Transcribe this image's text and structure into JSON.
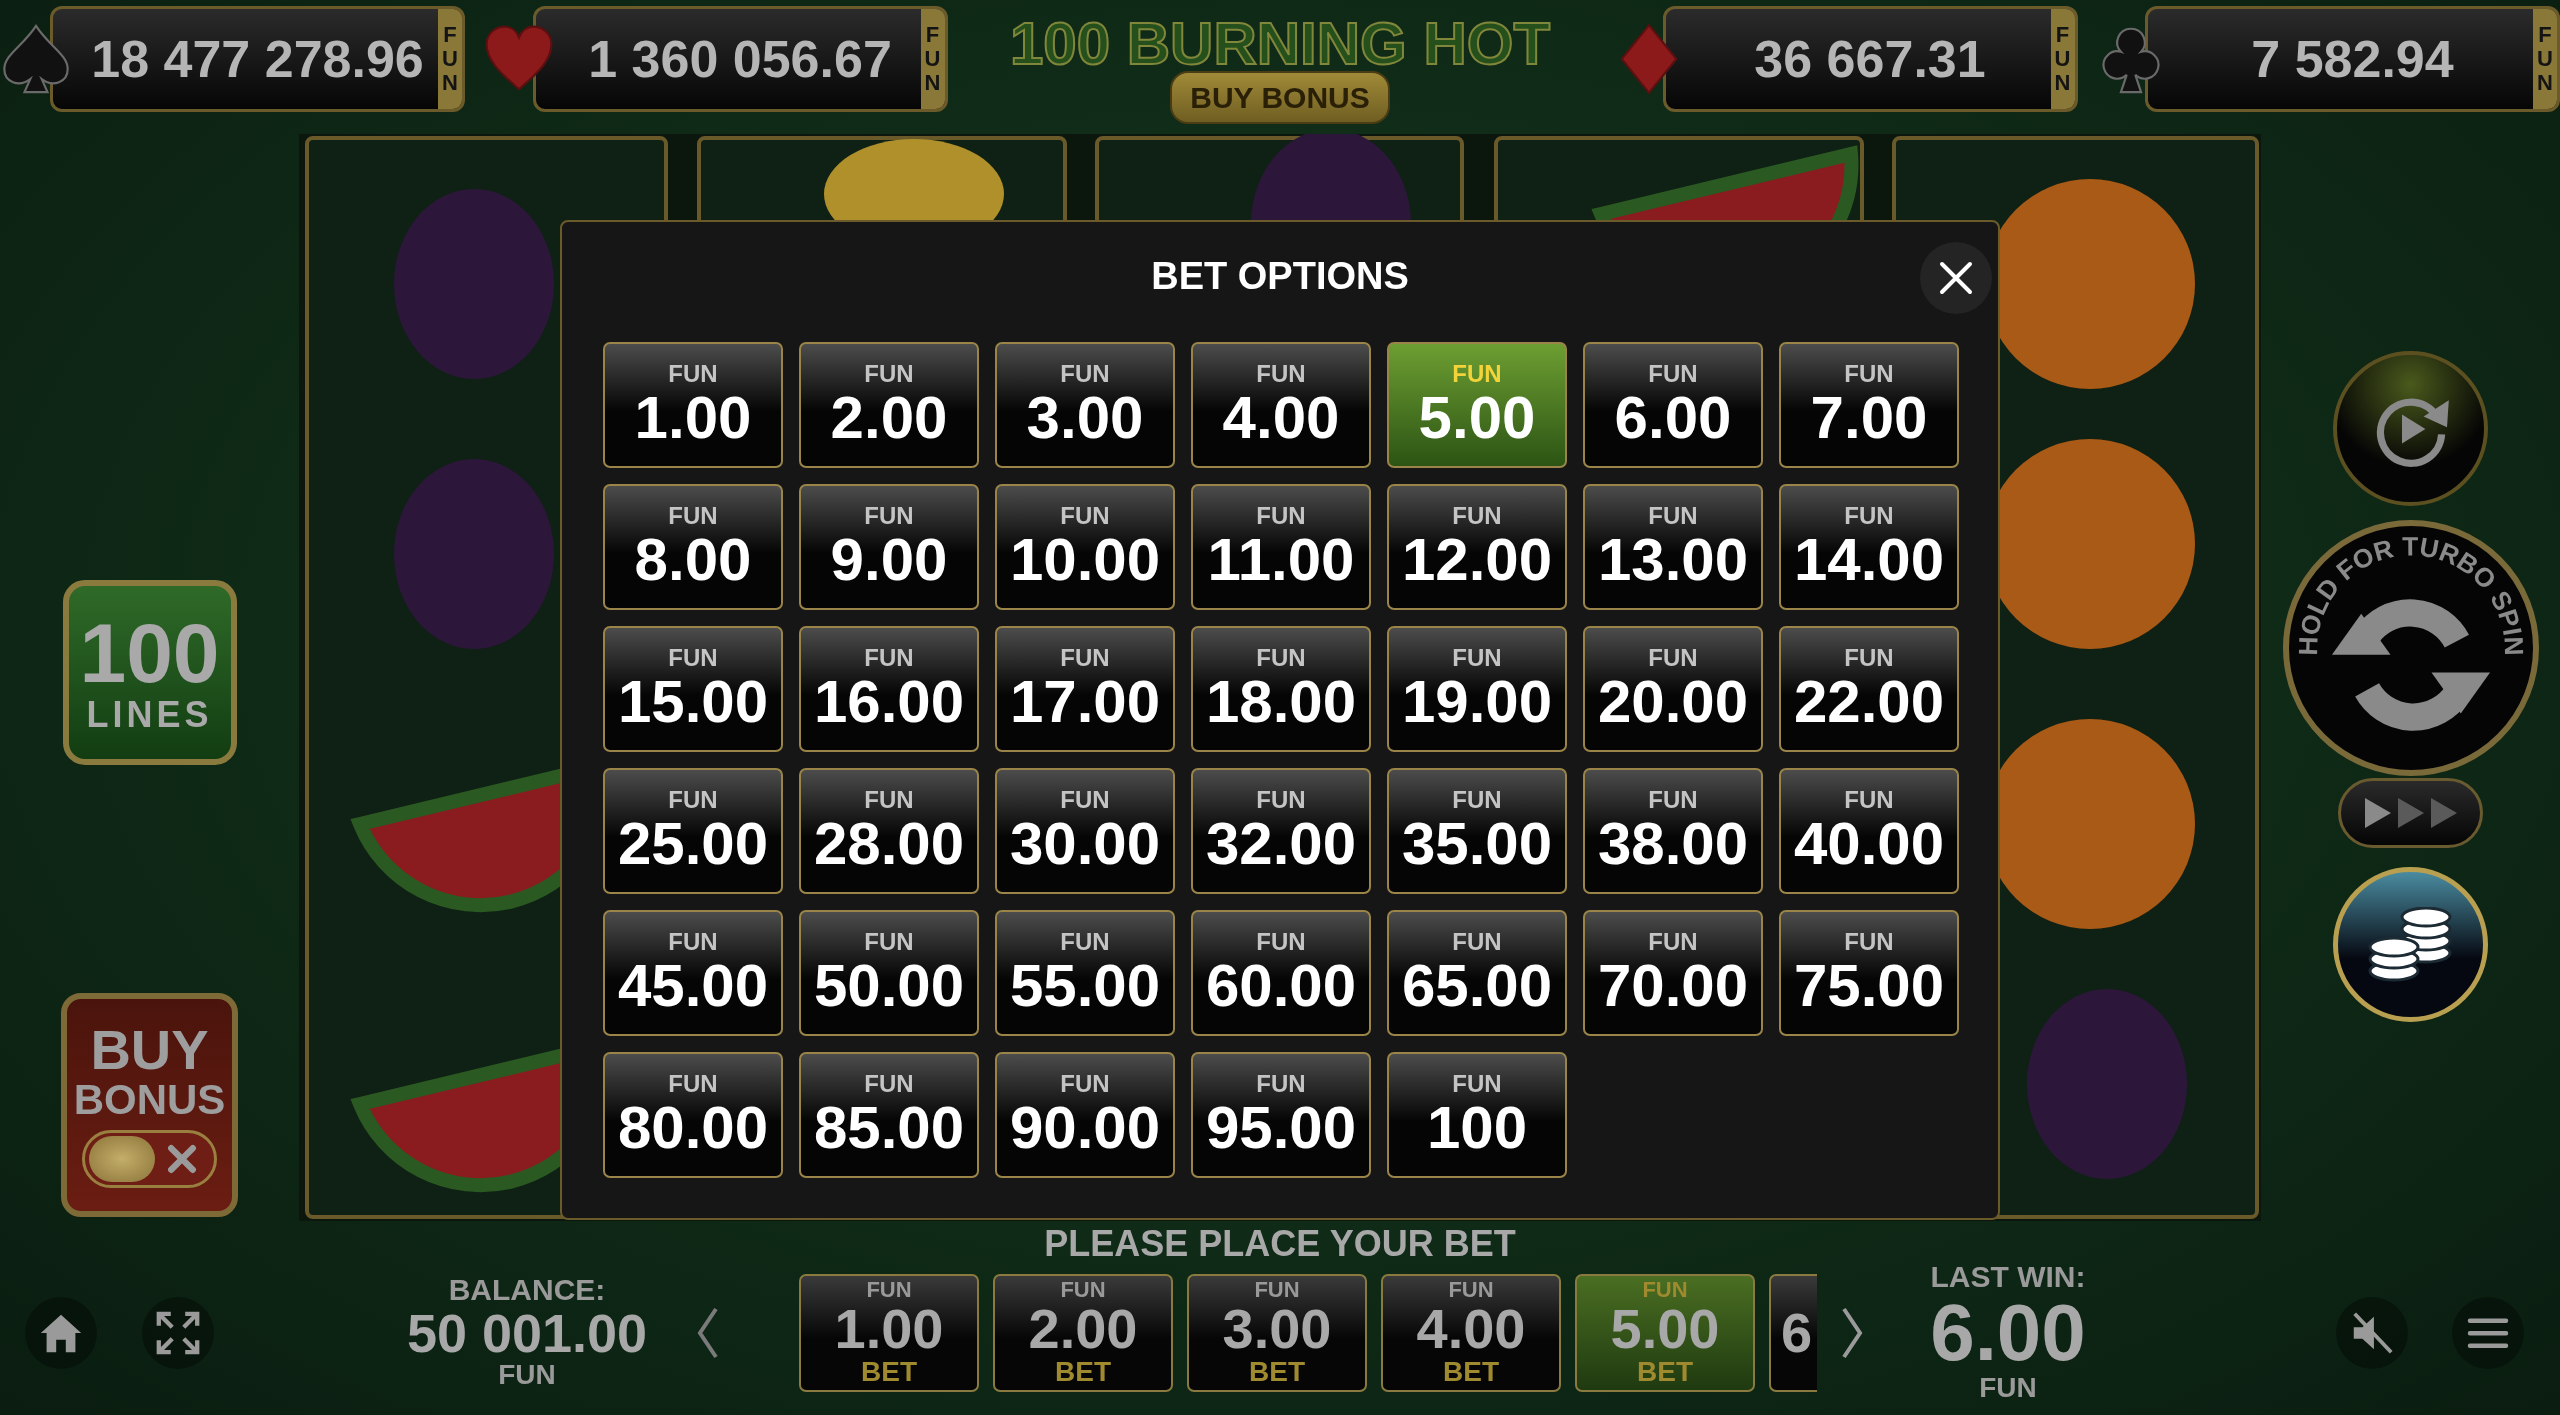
{
  "jackpots": [
    {
      "kind": "spade",
      "amount": "18 477 278.96",
      "currency": "FUN"
    },
    {
      "kind": "heart",
      "amount": "1 360 056.67",
      "currency": "FUN"
    },
    {
      "kind": "diamond",
      "amount": "36 667.31",
      "currency": "FUN"
    },
    {
      "kind": "club",
      "amount": "7 582.94",
      "currency": "FUN"
    }
  ],
  "game_title": "100 BURNING HOT",
  "title_badge": "BUY BONUS",
  "lines_badge": {
    "number": "100",
    "label": "LINES"
  },
  "buy_bonus_button": {
    "line1": "BUY",
    "line2": "BONUS",
    "on": false
  },
  "turbo_button": {
    "label": "HOLD FOR TURBO SPIN"
  },
  "dialog": {
    "title": "BET OPTIONS",
    "options": [
      {
        "currency": "FUN",
        "amount": "1.00",
        "selected": false
      },
      {
        "currency": "FUN",
        "amount": "2.00",
        "selected": false
      },
      {
        "currency": "FUN",
        "amount": "3.00",
        "selected": false
      },
      {
        "currency": "FUN",
        "amount": "4.00",
        "selected": false
      },
      {
        "currency": "FUN",
        "amount": "5.00",
        "selected": true
      },
      {
        "currency": "FUN",
        "amount": "6.00",
        "selected": false
      },
      {
        "currency": "FUN",
        "amount": "7.00",
        "selected": false
      },
      {
        "currency": "FUN",
        "amount": "8.00",
        "selected": false
      },
      {
        "currency": "FUN",
        "amount": "9.00",
        "selected": false
      },
      {
        "currency": "FUN",
        "amount": "10.00",
        "selected": false
      },
      {
        "currency": "FUN",
        "amount": "11.00",
        "selected": false
      },
      {
        "currency": "FUN",
        "amount": "12.00",
        "selected": false
      },
      {
        "currency": "FUN",
        "amount": "13.00",
        "selected": false
      },
      {
        "currency": "FUN",
        "amount": "14.00",
        "selected": false
      },
      {
        "currency": "FUN",
        "amount": "15.00",
        "selected": false
      },
      {
        "currency": "FUN",
        "amount": "16.00",
        "selected": false
      },
      {
        "currency": "FUN",
        "amount": "17.00",
        "selected": false
      },
      {
        "currency": "FUN",
        "amount": "18.00",
        "selected": false
      },
      {
        "currency": "FUN",
        "amount": "19.00",
        "selected": false
      },
      {
        "currency": "FUN",
        "amount": "20.00",
        "selected": false
      },
      {
        "currency": "FUN",
        "amount": "22.00",
        "selected": false
      },
      {
        "currency": "FUN",
        "amount": "25.00",
        "selected": false
      },
      {
        "currency": "FUN",
        "amount": "28.00",
        "selected": false
      },
      {
        "currency": "FUN",
        "amount": "30.00",
        "selected": false
      },
      {
        "currency": "FUN",
        "amount": "32.00",
        "selected": false
      },
      {
        "currency": "FUN",
        "amount": "35.00",
        "selected": false
      },
      {
        "currency": "FUN",
        "amount": "38.00",
        "selected": false
      },
      {
        "currency": "FUN",
        "amount": "40.00",
        "selected": false
      },
      {
        "currency": "FUN",
        "amount": "45.00",
        "selected": false
      },
      {
        "currency": "FUN",
        "amount": "50.00",
        "selected": false
      },
      {
        "currency": "FUN",
        "amount": "55.00",
        "selected": false
      },
      {
        "currency": "FUN",
        "amount": "60.00",
        "selected": false
      },
      {
        "currency": "FUN",
        "amount": "65.00",
        "selected": false
      },
      {
        "currency": "FUN",
        "amount": "70.00",
        "selected": false
      },
      {
        "currency": "FUN",
        "amount": "75.00",
        "selected": false
      },
      {
        "currency": "FUN",
        "amount": "80.00",
        "selected": false
      },
      {
        "currency": "FUN",
        "amount": "85.00",
        "selected": false
      },
      {
        "currency": "FUN",
        "amount": "90.00",
        "selected": false
      },
      {
        "currency": "FUN",
        "amount": "95.00",
        "selected": false
      },
      {
        "currency": "FUN",
        "amount": "100",
        "selected": false
      }
    ]
  },
  "prompt": "PLEASE PLACE YOUR BET",
  "balance": {
    "label": "BALANCE:",
    "amount": "50 001.00",
    "currency": "FUN"
  },
  "bet_strip": [
    {
      "currency": "FUN",
      "amount": "1.00",
      "unit": "BET",
      "selected": false
    },
    {
      "currency": "FUN",
      "amount": "2.00",
      "unit": "BET",
      "selected": false
    },
    {
      "currency": "FUN",
      "amount": "3.00",
      "unit": "BET",
      "selected": false
    },
    {
      "currency": "FUN",
      "amount": "4.00",
      "unit": "BET",
      "selected": false
    },
    {
      "currency": "FUN",
      "amount": "5.00",
      "unit": "BET",
      "selected": true
    },
    {
      "amount": "6",
      "selected": false
    }
  ],
  "last_win": {
    "label": "LAST WIN:",
    "amount": "6.00",
    "currency": "FUN"
  },
  "sound": {
    "muted": true
  }
}
